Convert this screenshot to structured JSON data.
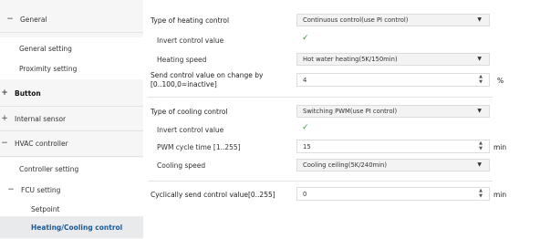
{
  "sidebar": {
    "items": [
      {
        "symbol": "−",
        "label": "General"
      },
      {
        "symbol": "",
        "label": "General setting"
      },
      {
        "symbol": "",
        "label": "Proximity setting"
      },
      {
        "symbol": "+",
        "label": "Button"
      },
      {
        "symbol": "+",
        "label": "Internal sensor"
      },
      {
        "symbol": "−",
        "label": "HVAC controller"
      },
      {
        "symbol": "",
        "label": "Controller setting"
      },
      {
        "symbol": "−",
        "label": "FCU setting"
      },
      {
        "symbol": "",
        "label": "Setpoint"
      },
      {
        "symbol": "",
        "label": "Heating/Cooling control"
      }
    ]
  },
  "heating": {
    "type_label": "Type of heating control",
    "type_value": "Continuous control(use PI control)",
    "invert_label": "Invert control value",
    "invert_checked": "✓",
    "speed_label": "Heating speed",
    "speed_value": "Hot water heating(5K/150min)",
    "send_label_1": "Send control value on change by",
    "send_label_2": "[0..100,0=inactive]",
    "send_value": "4",
    "send_unit": "%"
  },
  "cooling": {
    "type_label": "Type of cooling control",
    "type_value": "Switching PWM(use PI control)",
    "invert_label": "Invert control value",
    "invert_checked": "✓",
    "pwm_label": "PWM cycle time [1..255]",
    "pwm_value": "15",
    "pwm_unit": "min",
    "speed_label": "Cooling speed",
    "speed_value": "Cooling ceiling(5K/240min)"
  },
  "cyclic": {
    "label": "Cyclically send control value[0..255]",
    "value": "0",
    "unit": "min"
  },
  "icons": {
    "caret": "▼",
    "spin_up": "▲",
    "spin_down": "▼"
  }
}
